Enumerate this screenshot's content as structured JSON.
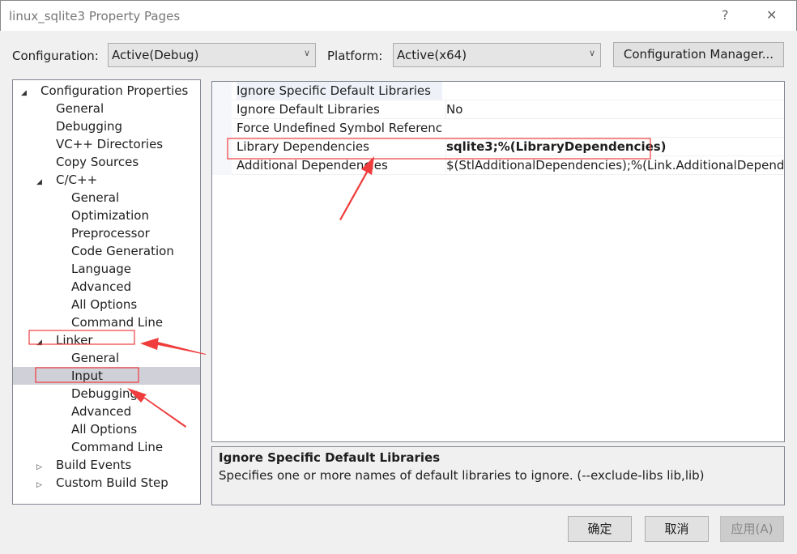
{
  "window": {
    "title": "linux_sqlite3 Property Pages",
    "help": "?",
    "close": "✕"
  },
  "toolbar": {
    "configuration_label": "Configuration:",
    "configuration_value": "Active(Debug)",
    "platform_label": "Platform:",
    "platform_value": "Active(x64)",
    "config_manager": "Configuration Manager..."
  },
  "tree": [
    {
      "label": "Configuration Properties",
      "level": 0,
      "expander": "◢"
    },
    {
      "label": "General",
      "level": 1
    },
    {
      "label": "Debugging",
      "level": 1
    },
    {
      "label": "VC++ Directories",
      "level": 1
    },
    {
      "label": "Copy Sources",
      "level": 1
    },
    {
      "label": "C/C++",
      "level": 1,
      "expander": "◢"
    },
    {
      "label": "General",
      "level": 2
    },
    {
      "label": "Optimization",
      "level": 2
    },
    {
      "label": "Preprocessor",
      "level": 2
    },
    {
      "label": "Code Generation",
      "level": 2
    },
    {
      "label": "Language",
      "level": 2
    },
    {
      "label": "Advanced",
      "level": 2
    },
    {
      "label": "All Options",
      "level": 2
    },
    {
      "label": "Command Line",
      "level": 2
    },
    {
      "label": "Linker",
      "level": 1,
      "expander": "◢"
    },
    {
      "label": "General",
      "level": 2
    },
    {
      "label": "Input",
      "level": 2,
      "selected": true
    },
    {
      "label": "Debugging",
      "level": 2
    },
    {
      "label": "Advanced",
      "level": 2
    },
    {
      "label": "All Options",
      "level": 2
    },
    {
      "label": "Command Line",
      "level": 2
    },
    {
      "label": "Build Events",
      "level": 1,
      "expander": "▷"
    },
    {
      "label": "Custom Build Step",
      "level": 1,
      "expander": "▷"
    }
  ],
  "properties": [
    {
      "name": "Ignore Specific Default Libraries",
      "value": ""
    },
    {
      "name": "Ignore Default Libraries",
      "value": "No"
    },
    {
      "name": "Force Undefined Symbol References",
      "value": ""
    },
    {
      "name": "Library Dependencies",
      "value": "sqlite3;%(LibraryDependencies)",
      "bold": true
    },
    {
      "name": "Additional Dependencies",
      "value": "$(StlAdditionalDependencies);%(Link.AdditionalDependencies)"
    }
  ],
  "description": {
    "heading": "Ignore Specific Default Libraries",
    "text": "Specifies one or more names of default libraries to ignore. (--exclude-libs lib,lib)"
  },
  "buttons": {
    "ok": "确定",
    "cancel": "取消",
    "apply": "应用(A)"
  },
  "annotation_color": "#f03c3c"
}
